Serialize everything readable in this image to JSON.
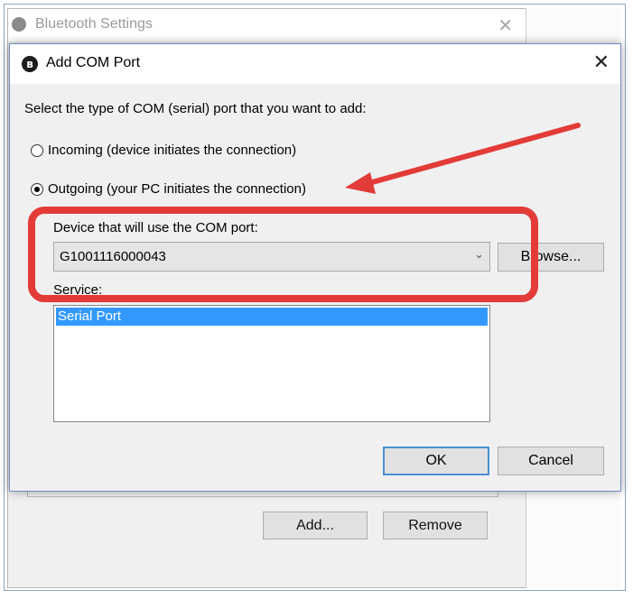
{
  "background_window": {
    "title": "Bluetooth Settings",
    "buttons": {
      "add_label": "Add...",
      "remove_label": "Remove"
    }
  },
  "dialog": {
    "title": "Add COM Port",
    "instruction": "Select the type of COM (serial) port that you want to add:",
    "incoming_label": "Incoming (device initiates the connection)",
    "outgoing_label": "Outgoing (your PC initiates the connection)",
    "selected_direction": "outgoing",
    "device_label": "Device that will use the COM port:",
    "device_value": "G1001116000043",
    "browse_label": "Browse...",
    "service_label": "Service:",
    "services": [
      "Serial Port"
    ],
    "ok_label": "OK",
    "cancel_label": "Cancel"
  },
  "colors": {
    "annotation": "#e23b38",
    "selection": "#3399ff",
    "dialog_border": "#6f8fc4"
  }
}
